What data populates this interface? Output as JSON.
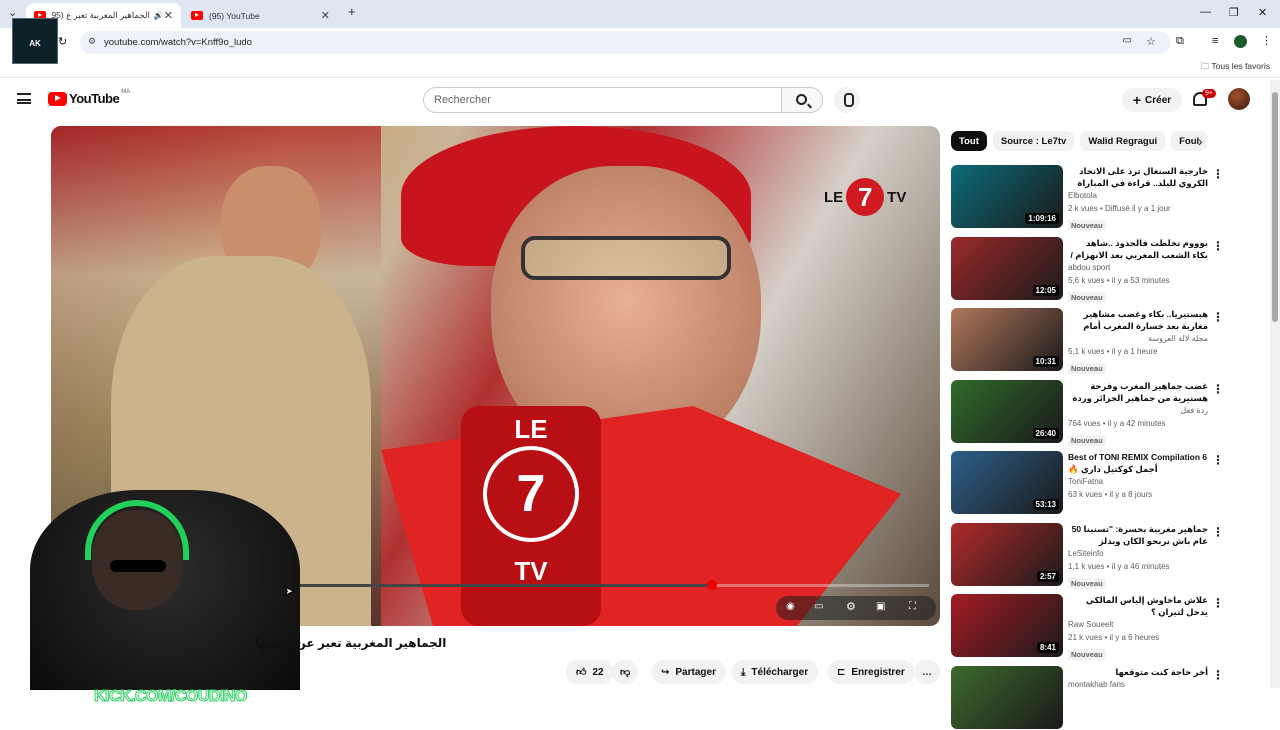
{
  "browser": {
    "tabs": [
      {
        "title": "الجماهير المغربية تعبر ع (95)",
        "active": true
      },
      {
        "title": "(95) YouTube",
        "active": false
      }
    ],
    "new_tab": "+",
    "url": "youtube.com/watch?v=Knff9o_ludo",
    "bookmarks_all": "Tous les favoris",
    "overlay_badge": "AK"
  },
  "youtube": {
    "logo": "YouTube",
    "country": "MA",
    "search_placeholder": "Rechercher",
    "create_label": "Créer",
    "notif_count": "9+",
    "accent": "#ff0000"
  },
  "video": {
    "title": "الجماهير المغربية تعبر عن غضبها",
    "watermark_le": "LE",
    "watermark_7": "7",
    "watermark_tv": "TV",
    "progress": 0.655,
    "likes": "22",
    "actions": {
      "share": "Partager",
      "download": "Télécharger",
      "save": "Enregistrer",
      "more": "…"
    }
  },
  "overlay": {
    "kick": "KICK.COM/COUDINO"
  },
  "chips": [
    "Tout",
    "Source : Le7tv",
    "Walid Regragui",
    "Foul"
  ],
  "recommendations": [
    {
      "title": "خارجية السنغال ترد على الاتحاد الكروي للبلد.. قراءة في المباراة النهائية وجماهرية",
      "channel": "Elbotola",
      "stats": "2 k vues • Diffusé il y a 1 jour",
      "badge": "Nouveau",
      "duration": "1:09:16",
      "thumb": "#0d6b7a"
    },
    {
      "title": "بوووم تخلطت فالحدود ..شاهد بكاء الشعب المغربي بعد الانهزام /السنغال تعتبر",
      "channel": "abdou sport",
      "stats": "5,6 k vues • il y a 53 minutes",
      "badge": "Nouveau",
      "duration": "12:05",
      "thumb": "#9a2a2a"
    },
    {
      "title": "هيستيريا.. بكاء وغضب مشاهير مغاربة بعد خسارة المغرب أمام السنغال واقحام الجمهور",
      "channel": "مجلة لالة العروسة",
      "stats": "5,1 k vues • il y a 1 heure",
      "badge": "Nouveau",
      "duration": "10:31",
      "thumb": "#b2785a"
    },
    {
      "title": "غضب جماهير المغرب وفرحة هستيرية من جماهير الجزائر وردة فعل سعودية مصرية",
      "channel": "ردة فعل",
      "stats": "764 vues • il y a 42 minutes",
      "badge": "Nouveau",
      "duration": "26:40",
      "thumb": "#2f6b2a"
    },
    {
      "title": "Best of TONI REMIX Compilation 6 🔥 أجمل كوكتيل داري",
      "channel": "ToniFatna",
      "stats": "63 k vues • il y a 8 jours",
      "badge": "",
      "duration": "53:13",
      "thumb": "#2d5f8a"
    },
    {
      "title": "جماهير مغربية بحسرة: \"تسنينا 50 عام باش نربحو الكان وبدلز ضاربب لنا بينالتي بنابنيكة\"",
      "channel": "LeSiteinfo",
      "stats": "1,1 k vues • il y a 46 minutes",
      "badge": "Nouveau",
      "duration": "2:57",
      "thumb": "#b02a2a"
    },
    {
      "title": "علاش ماخاوش إلياس المالكي يدخل لتيران ؟",
      "channel": "Raw Soueelt",
      "stats": "21 k vues • il y a 6 heures",
      "badge": "Nouveau",
      "duration": "8:41",
      "thumb": "#a51c24"
    },
    {
      "title": "أخر حاجة كنت متوقعها",
      "channel": "montakhab fans",
      "stats": "",
      "badge": "",
      "duration": "",
      "thumb": "#3d6a2c"
    }
  ]
}
